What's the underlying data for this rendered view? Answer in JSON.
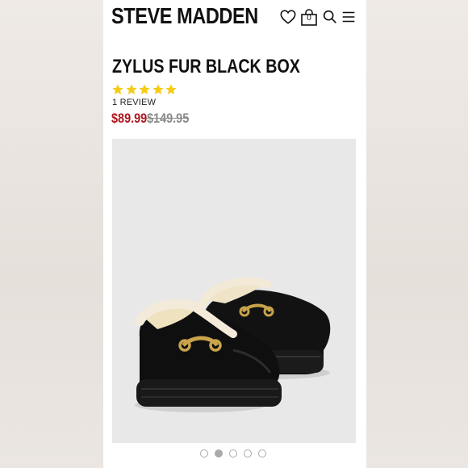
{
  "brand": {
    "logo_text": "STEVE MADDEN"
  },
  "header": {
    "icons": [
      "heart-icon",
      "bag-icon",
      "search-icon",
      "menu-icon"
    ],
    "bag_count": "0"
  },
  "product": {
    "title": "ZYLUS FUR BLACK BOX",
    "rating": 5,
    "rating_max": 5,
    "reviews_label": "1 REVIEW",
    "sale_price": "$89.99",
    "original_price": "$149.95"
  },
  "carousel": {
    "total": 5,
    "active": 2
  },
  "colors": {
    "sale": "#b0121b",
    "star": "#f5cc16",
    "strike": "#8a8a8a"
  }
}
